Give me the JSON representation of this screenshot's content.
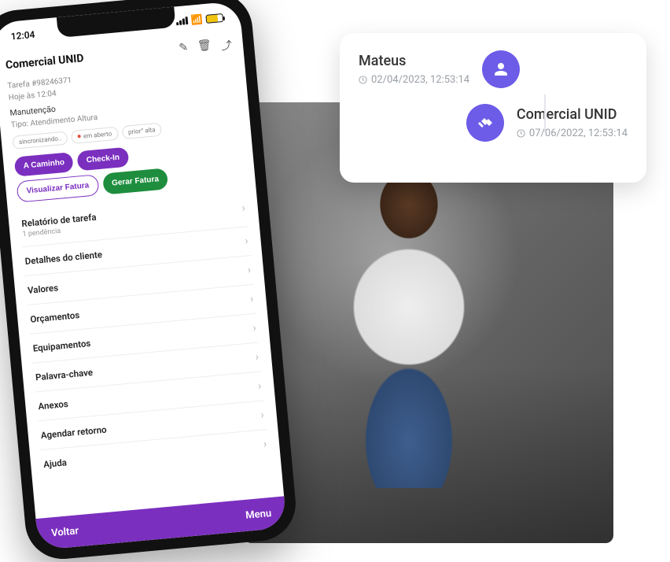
{
  "colors": {
    "accent": "#7b2fbf",
    "accent2": "#6c5ce7",
    "green": "#1e8e3e"
  },
  "card": {
    "top": {
      "name": "Mateus",
      "time": "02/04/2023, 12:53:14",
      "icon_name": "person-icon"
    },
    "bottom": {
      "name": "Comercial UNID",
      "time": "07/06/2022, 12:53:14",
      "icon_name": "handshake-icon"
    }
  },
  "phone": {
    "status": {
      "time": "12:04"
    },
    "header": {
      "title": "Comercial UNID",
      "icons": {
        "edit": "edit-icon",
        "trash": "trash-icon",
        "share": "share-icon"
      }
    },
    "meta": {
      "task_id": "Tarefa #98246371",
      "today": "Hoje às 12:04",
      "category": "Manutenção",
      "type": "Tipo: Atendimento Altura"
    },
    "status_chips": [
      {
        "label": "sincronizando..",
        "dot": false
      },
      {
        "label": "em aberto",
        "dot": true
      },
      {
        "label": "prior° alta",
        "dot": false
      }
    ],
    "buttons": {
      "a_caminho": "A Caminho",
      "check_in": "Check-In",
      "visualizar": "Visualizar Fatura",
      "gerar": "Gerar Fatura"
    },
    "menu": [
      {
        "label": "Relatório de tarefa",
        "sub": "1 pendência"
      },
      {
        "label": "Detalhes do cliente"
      },
      {
        "label": "Valores"
      },
      {
        "label": "Orçamentos"
      },
      {
        "label": "Equipamentos"
      },
      {
        "label": "Palavra-chave"
      },
      {
        "label": "Anexos"
      },
      {
        "label": "Agendar retorno"
      },
      {
        "label": "Ajuda"
      }
    ],
    "footer": {
      "voltar": "Voltar",
      "menu": "Menu"
    }
  }
}
